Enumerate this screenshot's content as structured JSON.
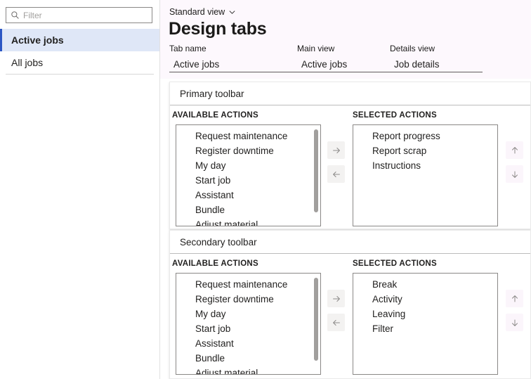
{
  "sidebar": {
    "filter": {
      "value": "",
      "placeholder": "Filter",
      "icon": "search-icon"
    },
    "items": [
      {
        "label": "Active jobs",
        "selected": true
      },
      {
        "label": "All jobs",
        "selected": false
      }
    ]
  },
  "header": {
    "view_selector": {
      "label": "Standard view",
      "icon": "chevron-down-icon"
    },
    "title": "Design tabs",
    "fields": [
      {
        "label": "Tab name",
        "value": "Active jobs"
      },
      {
        "label": "Main view",
        "value": "Active jobs"
      },
      {
        "label": "Details view",
        "value": "Job details"
      }
    ]
  },
  "toolbars": [
    {
      "title": "Primary toolbar",
      "available_header": "AVAILABLE ACTIONS",
      "selected_header": "SELECTED ACTIONS",
      "available": [
        "Request maintenance",
        "Register downtime",
        "My day",
        "Start job",
        "Assistant",
        "Bundle",
        "Adjust material"
      ],
      "selected": [
        "Report progress",
        "Report scrap",
        "Instructions"
      ],
      "buttons": {
        "move_right": "arrow-right-icon",
        "move_left": "arrow-left-icon",
        "move_up": "arrow-up-icon",
        "move_down": "arrow-down-icon"
      }
    },
    {
      "title": "Secondary toolbar",
      "available_header": "AVAILABLE ACTIONS",
      "selected_header": "SELECTED ACTIONS",
      "available": [
        "Request maintenance",
        "Register downtime",
        "My day",
        "Start job",
        "Assistant",
        "Bundle",
        "Adjust material"
      ],
      "selected": [
        "Break",
        "Activity",
        "Leaving",
        "Filter"
      ],
      "buttons": {
        "move_right": "arrow-right-icon",
        "move_left": "arrow-left-icon",
        "move_up": "arrow-up-icon",
        "move_down": "arrow-down-icon"
      }
    }
  ],
  "colors": {
    "accent": "#2b56c4",
    "selected_row": "#dfe7f7",
    "header_bg": "#fdf8fd",
    "border": "#8a8886"
  }
}
